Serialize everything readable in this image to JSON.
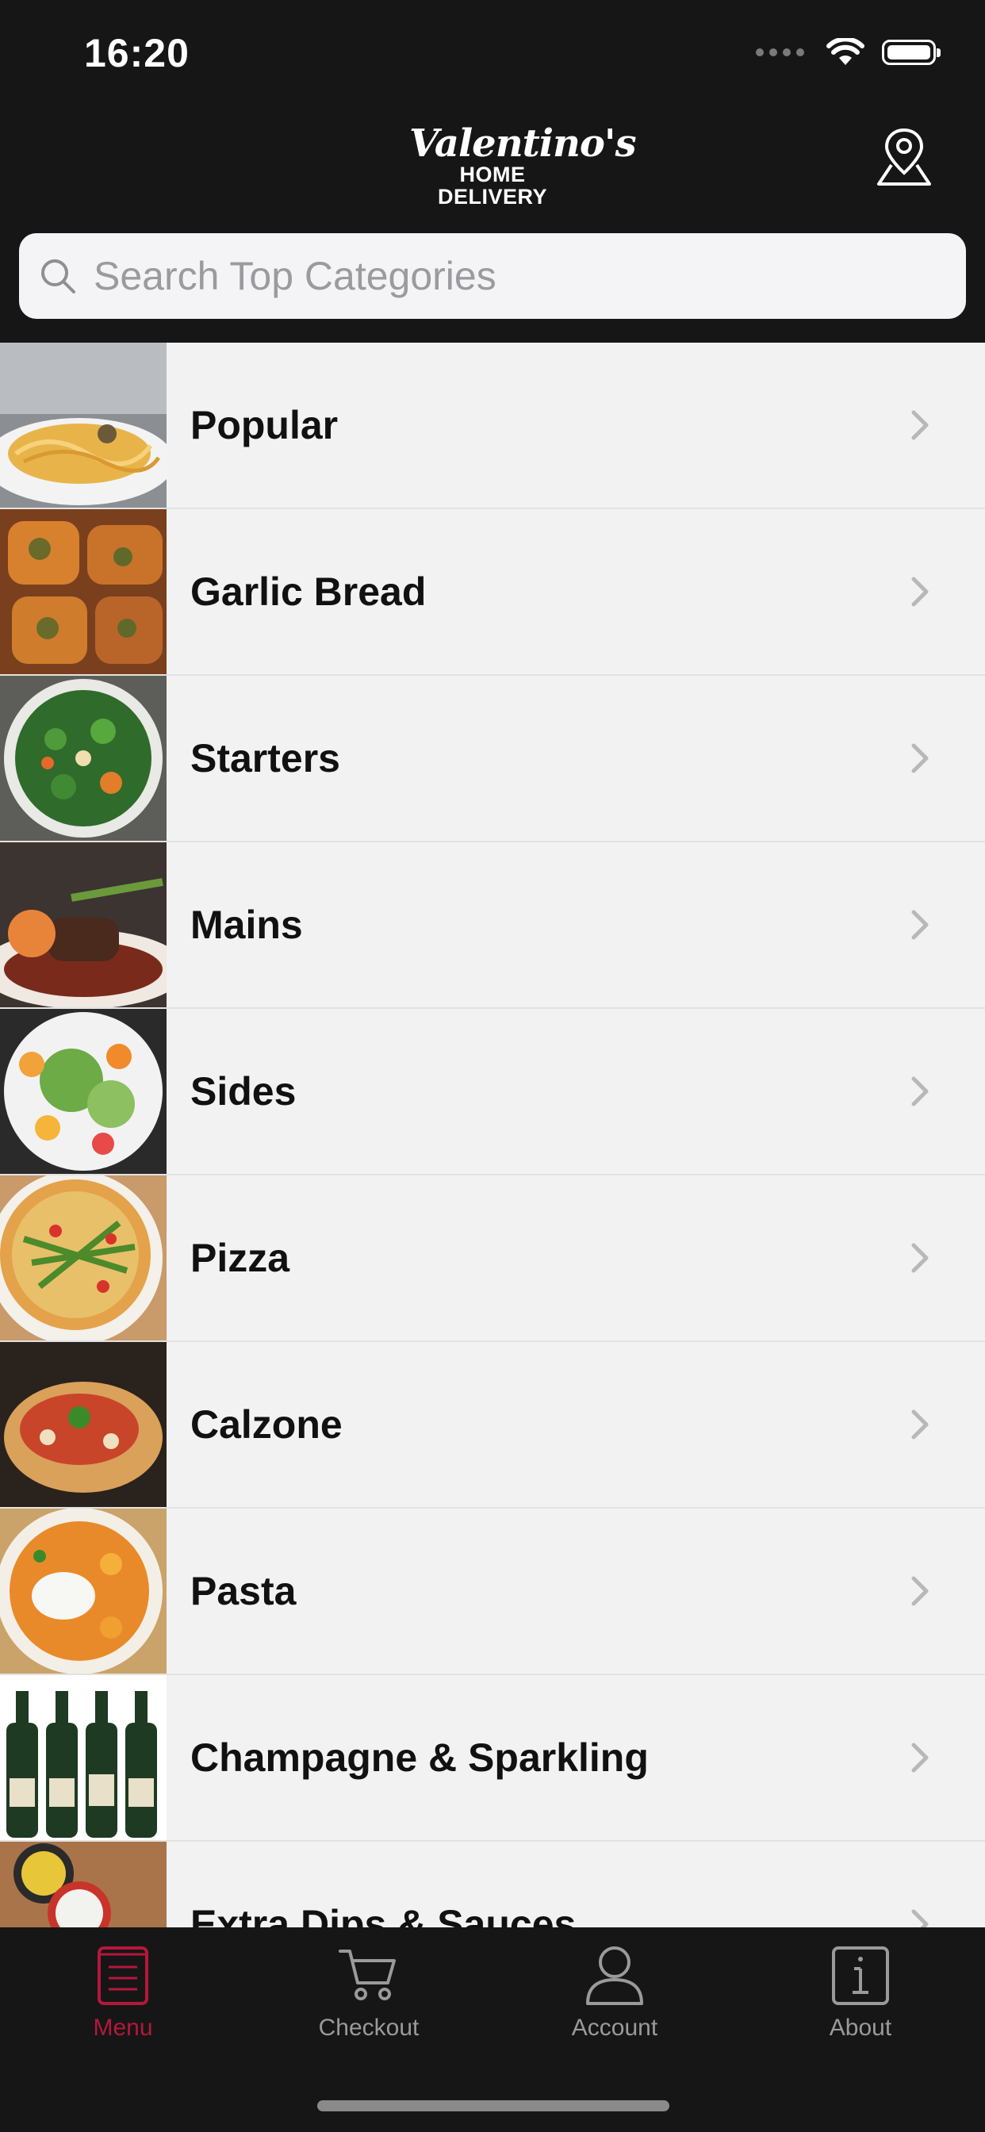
{
  "status_bar": {
    "time": "16:20"
  },
  "header": {
    "logo_script": "Valentino's",
    "logo_sub": "HOME DELIVERY",
    "location_icon": "map-pin-icon"
  },
  "search": {
    "placeholder": "Search Top Categories",
    "value": ""
  },
  "categories": [
    {
      "label": "Popular",
      "thumb": "pasta-carbonara"
    },
    {
      "label": "Garlic Bread",
      "thumb": "garlic-bread"
    },
    {
      "label": "Starters",
      "thumb": "salad-bowl"
    },
    {
      "label": "Mains",
      "thumb": "steak-plate"
    },
    {
      "label": "Sides",
      "thumb": "side-salad"
    },
    {
      "label": "Pizza",
      "thumb": "rocket-pizza"
    },
    {
      "label": "Calzone",
      "thumb": "calzone"
    },
    {
      "label": "Pasta",
      "thumb": "pasta-burrata"
    },
    {
      "label": "Champagne & Sparkling",
      "thumb": "champagne-bottles"
    },
    {
      "label": "Extra Dips & Sauces",
      "thumb": "dip-bowls"
    }
  ],
  "tabbar": {
    "tabs": [
      {
        "label": "Menu",
        "icon": "menu-icon",
        "active": true
      },
      {
        "label": "Checkout",
        "icon": "cart-icon",
        "active": false
      },
      {
        "label": "Account",
        "icon": "person-icon",
        "active": false
      },
      {
        "label": "About",
        "icon": "info-icon",
        "active": false
      }
    ]
  },
  "colors": {
    "header_bg": "#161616",
    "accent": "#b5173c",
    "list_bg": "#f2f2f2"
  }
}
